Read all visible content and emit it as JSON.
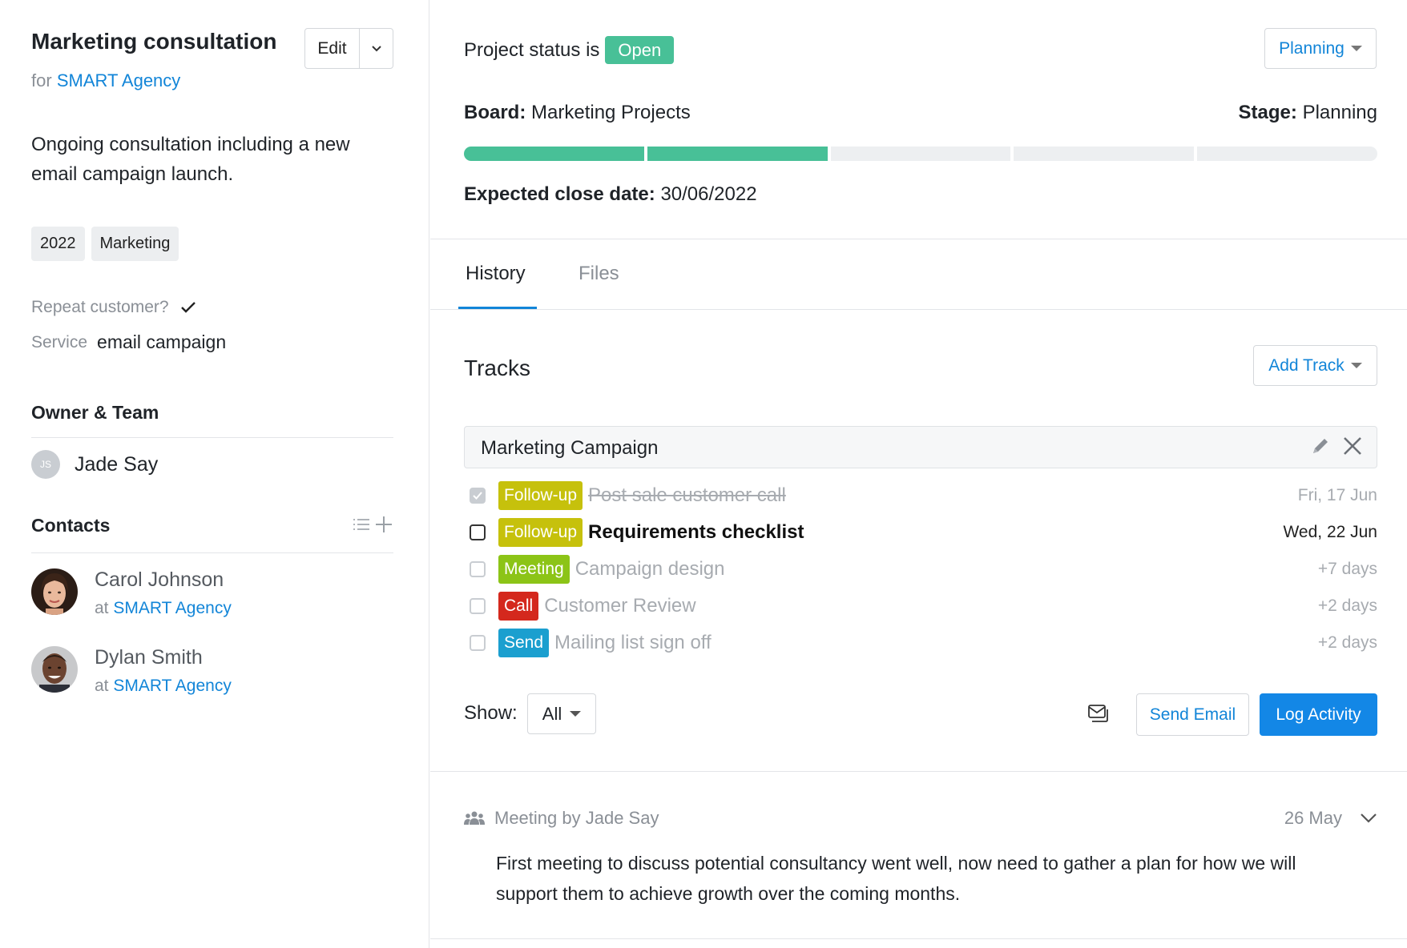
{
  "deal": {
    "title": "Marketing consultation",
    "for_prefix": "for",
    "company": "SMART Agency",
    "edit_label": "Edit",
    "description": "Ongoing consultation including a new email campaign launch.",
    "tags": [
      "2022",
      "Marketing"
    ],
    "repeat_customer_label": "Repeat customer?",
    "repeat_customer_value": true,
    "service_label": "Service",
    "service_value": "email campaign"
  },
  "owner_team": {
    "heading": "Owner & Team",
    "owner_initials": "JS",
    "owner_name": "Jade Say"
  },
  "contacts": {
    "heading": "Contacts",
    "items": [
      {
        "name": "Carol Johnson",
        "at_prefix": "at",
        "company": "SMART Agency"
      },
      {
        "name": "Dylan Smith",
        "at_prefix": "at",
        "company": "SMART Agency"
      }
    ]
  },
  "project": {
    "status_prefix": "Project status is",
    "status": "Open",
    "status_color": "#48c097",
    "stage_dropdown": "Planning",
    "board_label": "Board:",
    "board_value": "Marketing Projects",
    "stage_label": "Stage:",
    "stage_value": "Planning",
    "stages_total": 5,
    "stages_completed": 2,
    "close_date_label": "Expected close date:",
    "close_date_value": "30/06/2022"
  },
  "tabs": [
    {
      "label": "History",
      "active": true
    },
    {
      "label": "Files",
      "active": false
    }
  ],
  "tracks": {
    "heading": "Tracks",
    "add_track_label": "Add Track",
    "track_name": "Marketing Campaign",
    "tasks": [
      {
        "type": "Follow-up",
        "type_color": "#c6c10c",
        "name": "Post sale customer call",
        "date": "Fri, 17 Jun",
        "state": "done"
      },
      {
        "type": "Follow-up",
        "type_color": "#c6c10c",
        "name": "Requirements checklist",
        "date": "Wed, 22 Jun",
        "state": "current"
      },
      {
        "type": "Meeting",
        "type_color": "#8cc417",
        "name": "Campaign design",
        "date": "+7 days",
        "state": "pending"
      },
      {
        "type": "Call",
        "type_color": "#d4281d",
        "name": "Customer Review",
        "date": "+2 days",
        "state": "pending"
      },
      {
        "type": "Send",
        "type_color": "#1b9fcf",
        "name": "Mailing list sign off",
        "date": "+2 days",
        "state": "pending"
      }
    ]
  },
  "footer_controls": {
    "show_label": "Show:",
    "show_value": "All",
    "send_email_label": "Send Email",
    "log_activity_label": "Log Activity"
  },
  "activity": {
    "header": "Meeting by Jade Say",
    "date": "26 May",
    "body": "First meeting to discuss potential consultancy went well, now need to gather a plan for how we will support them to achieve growth over the coming months."
  },
  "colors": {
    "accent": "#1285d8",
    "primary_button": "#1387e6",
    "progress_on": "#48c097",
    "progress_off": "#edeff1"
  }
}
